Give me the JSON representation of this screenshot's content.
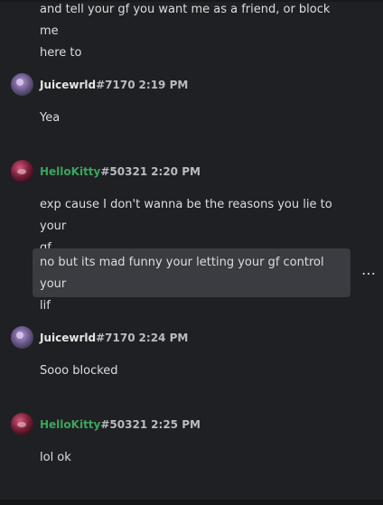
{
  "messages": [
    {
      "type": "continuation",
      "text": "and tell your gf you want me as a friend, or block me\nhere to"
    },
    {
      "author": "Juicewrld",
      "tag": "#7170",
      "time": "2:19 PM",
      "text": "Yea"
    },
    {
      "author": "HelloKitty",
      "tag": "#50321",
      "time": "2:20 PM",
      "text": "exp cause I don't wanna be the reasons you lie to your\ngf",
      "followup": "no but its mad funny your letting your gf control your\nlif"
    },
    {
      "author": "Juicewrld",
      "tag": "#7170",
      "time": "2:24 PM",
      "text": "Sooo blocked"
    },
    {
      "author": "HelloKitty",
      "tag": "#50321",
      "time": "2:25 PM",
      "text": "lol ok"
    }
  ],
  "more_icon": "…",
  "colors": {
    "background": "#1f2023",
    "highlight": "#3a3c41",
    "helloKittyName": "#3ba55c"
  }
}
